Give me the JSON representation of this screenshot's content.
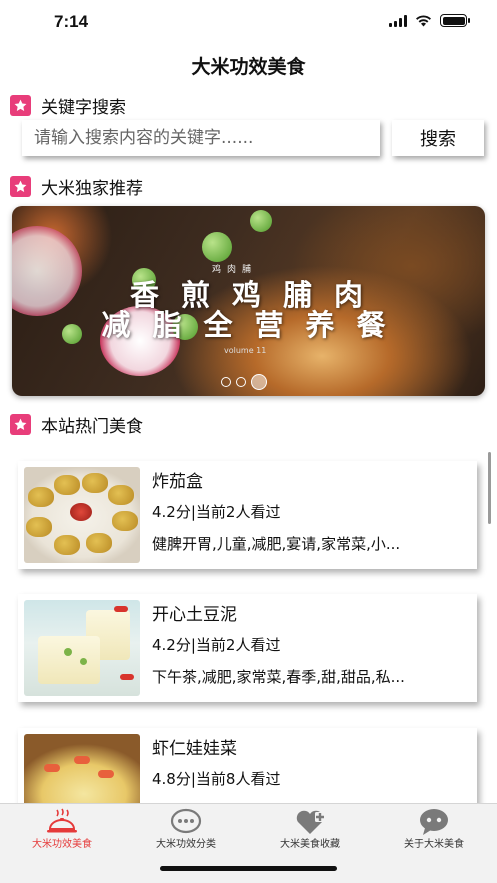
{
  "status_bar": {
    "time": "7:14"
  },
  "nav": {
    "title": "大米功效美食"
  },
  "sections": {
    "search": "关键字搜索",
    "recommend": "大米独家推荐",
    "hot": "本站热门美食"
  },
  "search": {
    "placeholder": "请输入搜索内容的关键字......",
    "button_label": "搜索"
  },
  "banner": {
    "small_text": "鸡肉脯",
    "line1": "香煎鸡脯肉",
    "line2": "减脂全营养餐",
    "vol_text": "volume 11",
    "slide_count": 3,
    "active_slide": 3
  },
  "foods": [
    {
      "name": "炸茄盒",
      "meta": "4.2分|当前2人看过",
      "tags": "健脾开胃,儿童,减肥,宴请,家常菜,小..."
    },
    {
      "name": "开心土豆泥",
      "meta": "4.2分|当前2人看过",
      "tags": "下午茶,减肥,家常菜,春季,甜,甜品,私..."
    },
    {
      "name": "虾仁娃娃菜",
      "meta": "4.8分|当前8人看过",
      "tags": ""
    }
  ],
  "tabs": [
    {
      "label": "大米功效美食",
      "icon": "cloche-icon",
      "active": true
    },
    {
      "label": "大米功效分类",
      "icon": "chat-dots-icon",
      "active": false
    },
    {
      "label": "大米美食收藏",
      "icon": "heart-plus-icon",
      "active": false
    },
    {
      "label": "关于大米美食",
      "icon": "chat-face-icon",
      "active": false
    }
  ],
  "colors": {
    "accent": "#e83d7a",
    "tab_active": "#e53a3a",
    "tab_icon": "#7a7a7a"
  }
}
